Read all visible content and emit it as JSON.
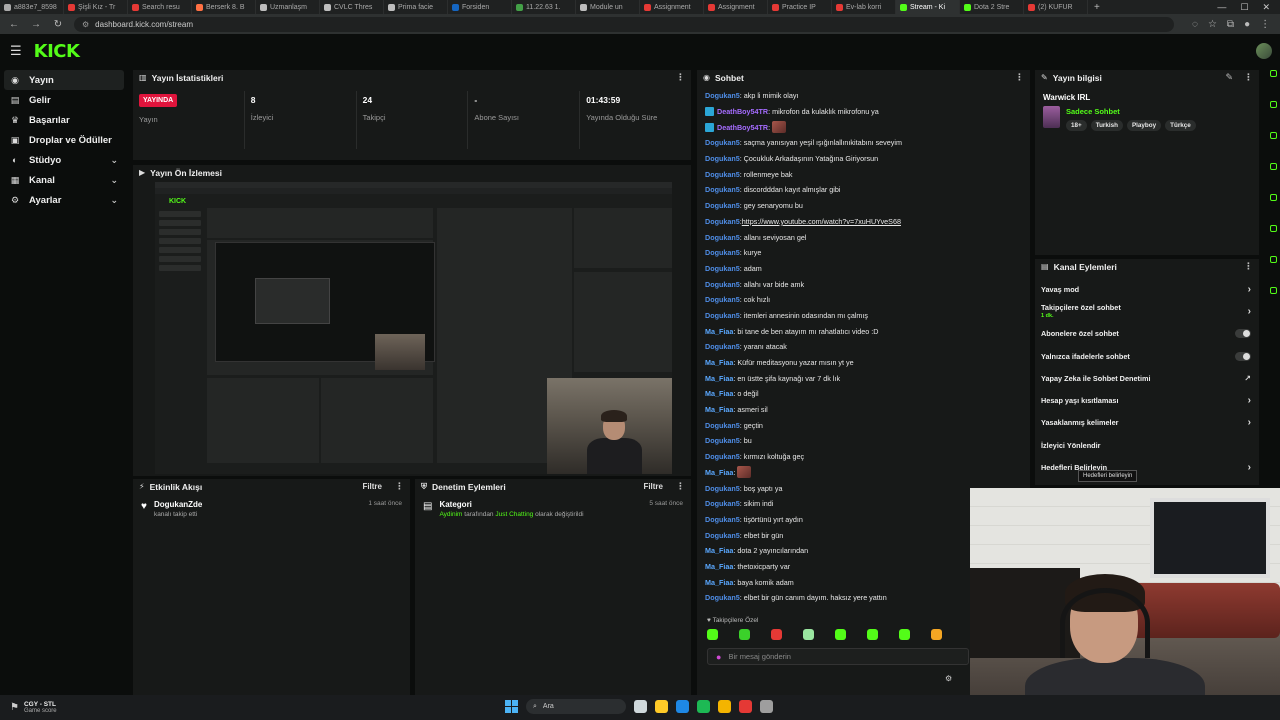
{
  "browser": {
    "tabs": [
      {
        "label": "a883e7_8598",
        "color": "#aaaaaa",
        "active": false
      },
      {
        "label": "Şişli Kız - Tr",
        "color": "#e53935",
        "active": false
      },
      {
        "label": "Search resu",
        "color": "#e53935",
        "active": false
      },
      {
        "label": "Berserk 8. B",
        "color": "#ff7043",
        "active": false
      },
      {
        "label": "Uzmanlaşm",
        "color": "#bdbdbd",
        "active": false
      },
      {
        "label": "CVLC Thres",
        "color": "#bdbdbd",
        "active": false
      },
      {
        "label": "Prima facie",
        "color": "#bdbdbd",
        "active": false
      },
      {
        "label": "Forsiden",
        "color": "#1565c0",
        "active": false
      },
      {
        "label": "11.22.63 1.",
        "color": "#43a047",
        "active": false
      },
      {
        "label": "Module un",
        "color": "#bdbdbd",
        "active": false
      },
      {
        "label": "Assignment",
        "color": "#e53935",
        "active": false
      },
      {
        "label": "Assignment",
        "color": "#e53935",
        "active": false
      },
      {
        "label": "Practice IP",
        "color": "#e53935",
        "active": false
      },
      {
        "label": "Ev-lab korri",
        "color": "#e53935",
        "active": false
      },
      {
        "label": "Stream - Ki",
        "color": "#53fc18",
        "active": true
      },
      {
        "label": "Dota 2 Stre",
        "color": "#53fc18",
        "active": false
      },
      {
        "label": "(2) KUFUR",
        "color": "#e53935",
        "active": false
      }
    ],
    "url": "dashboard.kick.com/stream"
  },
  "brand": {
    "logo": "KICK",
    "accent": "#53fc18"
  },
  "sidebar": {
    "items": [
      {
        "label": "Yayın",
        "icon": "broadcast-icon",
        "active": true,
        "chev": false
      },
      {
        "label": "Gelir",
        "icon": "wallet-icon",
        "active": false,
        "chev": false
      },
      {
        "label": "Başarılar",
        "icon": "trophy-icon",
        "active": false,
        "chev": false
      },
      {
        "label": "Droplar ve Ödüller",
        "icon": "gift-icon",
        "active": false,
        "chev": false
      },
      {
        "label": "Stüdyo",
        "icon": "studio-icon",
        "active": false,
        "chev": true
      },
      {
        "label": "Kanal",
        "icon": "channel-icon",
        "active": false,
        "chev": true
      },
      {
        "label": "Ayarlar",
        "icon": "gear-icon",
        "active": false,
        "chev": true
      }
    ]
  },
  "stats": {
    "title": "Yayın İstatistikleri",
    "live_badge": "YAYINDA",
    "items": [
      {
        "value": "",
        "label": "Yayın"
      },
      {
        "value": "8",
        "label": "İzleyici"
      },
      {
        "value": "24",
        "label": "Takipçi"
      },
      {
        "value": "-",
        "label": "Abone Sayısı"
      },
      {
        "value": "01:43:59",
        "label": "Yayında Olduğu Süre"
      }
    ]
  },
  "preview": {
    "title": "Yayın Ön İzlemesi"
  },
  "activity": {
    "title": "Etkinlik Akışı",
    "filter": "Filtre",
    "items": [
      {
        "name": "DogukanZde",
        "sub": "kanalı takip etti",
        "time": "1 saat önce"
      }
    ]
  },
  "moderation": {
    "title": "Denetim Eylemleri",
    "filter": "Filtre",
    "items": [
      {
        "name": "Kategori",
        "actor": "Aydinim",
        "middle": " tarafından ",
        "value": "Just Chatting",
        "suffix": " olarak değiştirildi",
        "time": "5 saat önce"
      }
    ]
  },
  "chat": {
    "title": "Sohbet",
    "messages": [
      {
        "user": "Dogukan5",
        "color": "blue",
        "text": ": akp li mimik olayı",
        "badge": false,
        "emote": false,
        "link": false
      },
      {
        "user": "DeathBoy54TR",
        "color": "purple",
        "text": ": mikrofon da kulaklık mikrofonu ya",
        "badge": true,
        "emote": false,
        "link": false
      },
      {
        "user": "DeathBoy54TR",
        "color": "purple",
        "text": ":",
        "badge": true,
        "emote": true,
        "link": false
      },
      {
        "user": "Dogukan5",
        "color": "blue",
        "text": ": saçma yanısıyan yeşil ışığınlallınıkitabını seveyim",
        "badge": false,
        "emote": false,
        "link": false
      },
      {
        "user": "Dogukan5",
        "color": "blue",
        "text": ": Çocukluk Arkadaşının Yatağına Giriyorsun",
        "badge": false,
        "emote": false,
        "link": false
      },
      {
        "user": "Dogukan5",
        "color": "blue",
        "text": ": rollenmeye bak",
        "badge": false,
        "emote": false,
        "link": false
      },
      {
        "user": "Dogukan5",
        "color": "blue",
        "text": ": discordddan kayıt almışlar gibi",
        "badge": false,
        "emote": false,
        "link": false
      },
      {
        "user": "Dogukan5",
        "color": "blue",
        "text": ": gey senaryomu bu",
        "badge": false,
        "emote": false,
        "link": false
      },
      {
        "user": "Dogukan5",
        "color": "blue",
        "text": "https://www.youtube.com/watch?v=7xuHUYveS68",
        "badge": false,
        "emote": false,
        "link": true
      },
      {
        "user": "Dogukan5",
        "color": "blue",
        "text": ": allanı seviyosan gel",
        "badge": false,
        "emote": false,
        "link": false
      },
      {
        "user": "Dogukan5",
        "color": "blue",
        "text": ": kurye",
        "badge": false,
        "emote": false,
        "link": false
      },
      {
        "user": "Dogukan5",
        "color": "blue",
        "text": ": adam",
        "badge": false,
        "emote": false,
        "link": false
      },
      {
        "user": "Dogukan5",
        "color": "blue",
        "text": ": allahı var bide amk",
        "badge": false,
        "emote": false,
        "link": false
      },
      {
        "user": "Dogukan5",
        "color": "blue",
        "text": ": cok hızlı",
        "badge": false,
        "emote": false,
        "link": false
      },
      {
        "user": "Dogukan5",
        "color": "blue",
        "text": ": itemleri annesinin odasından mı çalmış",
        "badge": false,
        "emote": false,
        "link": false
      },
      {
        "user": "Ma_Fiaa",
        "color": "cyan",
        "text": ": bi tane de ben atayım mı rahatlatıcı video :D",
        "badge": false,
        "emote": false,
        "link": false
      },
      {
        "user": "Dogukan5",
        "color": "blue",
        "text": ": yaranı atacak",
        "badge": false,
        "emote": false,
        "link": false
      },
      {
        "user": "Ma_Fiaa",
        "color": "cyan",
        "text": ": Küfür meditasyonu yazar mısın yt ye",
        "badge": false,
        "emote": false,
        "link": false
      },
      {
        "user": "Ma_Fiaa",
        "color": "cyan",
        "text": ": en üstte şifa kaynağı var 7 dk lık",
        "badge": false,
        "emote": false,
        "link": false
      },
      {
        "user": "Ma_Fiaa",
        "color": "cyan",
        "text": ": o değil",
        "badge": false,
        "emote": false,
        "link": false
      },
      {
        "user": "Ma_Fiaa",
        "color": "cyan",
        "text": ": asmeri sil",
        "badge": false,
        "emote": false,
        "link": false
      },
      {
        "user": "Dogukan5",
        "color": "blue",
        "text": ": geçtin",
        "badge": false,
        "emote": false,
        "link": false
      },
      {
        "user": "Dogukan5",
        "color": "blue",
        "text": ": bu",
        "badge": false,
        "emote": false,
        "link": false
      },
      {
        "user": "Dogukan5",
        "color": "blue",
        "text": ": kırmızı koltuğa geç",
        "badge": false,
        "emote": false,
        "link": false
      },
      {
        "user": "Ma_Fiaa",
        "color": "cyan",
        "text": ":",
        "badge": false,
        "emote": true,
        "link": false
      },
      {
        "user": "Dogukan5",
        "color": "blue",
        "text": ": boş yaptı ya",
        "badge": false,
        "emote": false,
        "link": false
      },
      {
        "user": "Dogukan5",
        "color": "blue",
        "text": ": sikim indi",
        "badge": false,
        "emote": false,
        "link": false
      },
      {
        "user": "Dogukan5",
        "color": "blue",
        "text": ": tişörtünü yırt aydın",
        "badge": false,
        "emote": false,
        "link": false
      },
      {
        "user": "Dogukan5",
        "color": "blue",
        "text": ": elbet bir gün",
        "badge": false,
        "emote": false,
        "link": false
      },
      {
        "user": "Ma_Fiaa",
        "color": "cyan",
        "text": ": dota 2 yayıncılarından",
        "badge": false,
        "emote": false,
        "link": false
      },
      {
        "user": "Ma_Fiaa",
        "color": "cyan",
        "text": ": thetoxicparty var",
        "badge": false,
        "emote": false,
        "link": false
      },
      {
        "user": "Ma_Fiaa",
        "color": "cyan",
        "text": ": baya komik adam",
        "badge": false,
        "emote": false,
        "link": false
      },
      {
        "user": "Dogukan5",
        "color": "blue",
        "text": ": elbet bir gün canım dayım. haksız yere yattın",
        "badge": false,
        "emote": false,
        "link": false
      }
    ],
    "followers_only": "Takipçilere Özel",
    "input_placeholder": "Bir mesaj gönderin",
    "emote_colors": [
      "#53fc18",
      "#3bd12a",
      "#e53935",
      "#9ae6a0",
      "#53fc18",
      "#53fc18",
      "#53fc18",
      "#f5a623"
    ]
  },
  "stream_info": {
    "title": "Yayın bilgisi",
    "stream_title": "Warwick IRL",
    "category": "Sadece Sohbet",
    "tags": [
      "18+",
      "Turkish",
      "Playboy",
      "Türkçe"
    ]
  },
  "channel_actions": {
    "title": "Kanal Eylemleri",
    "items": [
      {
        "label": "Yavaş mod",
        "sub": "",
        "control": "chevron"
      },
      {
        "label": "Takipçilere özel sohbet",
        "sub": "1 dk.",
        "control": "chevron"
      },
      {
        "label": "Abonelere özel sohbet",
        "sub": "",
        "control": "toggle"
      },
      {
        "label": "Yalnızca ifadelerle sohbet",
        "sub": "",
        "control": "toggle"
      },
      {
        "label": "Yapay Zeka ile Sohbet Denetimi",
        "sub": "",
        "control": "external"
      },
      {
        "label": "Hesap yaşı kısıtlaması",
        "sub": "",
        "control": "chevron"
      },
      {
        "label": "Yasaklanmış kelimeler",
        "sub": "",
        "control": "chevron"
      },
      {
        "label": "İzleyici Yönlendir",
        "sub": "",
        "control": "none"
      },
      {
        "label": "Hedefleri Belirleyin",
        "sub": "",
        "control": "chevron"
      }
    ],
    "tooltip": "Hedefleri belirleyin"
  },
  "taskbar": {
    "weather_title": "CGY - STL",
    "weather_sub": "Game score",
    "search_label": "Ara",
    "app_colors": [
      "#cfd8dc",
      "#ffca28",
      "#1e88e5",
      "#1db954",
      "#f4b400",
      "#e53935",
      "#9e9e9e"
    ]
  }
}
